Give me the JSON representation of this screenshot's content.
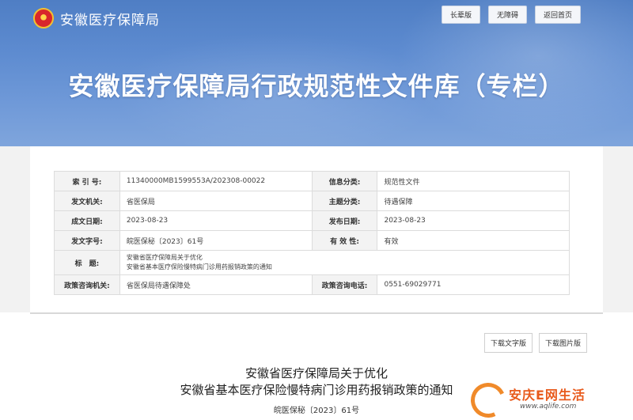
{
  "header": {
    "brand_name": "安徽医疗保障局",
    "top_buttons": [
      "长辈版",
      "无障碍",
      "返回首页"
    ],
    "banner_title": "安徽医疗保障局行政规范性文件库（专栏）"
  },
  "info": {
    "index_label": "索 引 号:",
    "index_value": "11340000MB1599553A/202308-00022",
    "category_label": "信息分类:",
    "category_value": "规范性文件",
    "issuer_label": "发文机关:",
    "issuer_value": "省医保局",
    "topic_label": "主题分类:",
    "topic_value": "待遇保障",
    "created_label": "成文日期:",
    "created_value": "2023-08-23",
    "published_label": "发布日期:",
    "published_value": "2023-08-23",
    "docnum_label": "发文字号:",
    "docnum_value": "皖医保秘〔2023〕61号",
    "validity_label": "有 效 性:",
    "validity_value": "有效",
    "title_label": "标　题:",
    "title_line1": "安徽省医疗保障局关于优化",
    "title_line2": "安徽省基本医疗保险慢特病门诊用药报销政策的通知",
    "consult_org_label": "政策咨询机关:",
    "consult_org_value": "省医保局待遇保障处",
    "consult_tel_label": "政策咨询电话:",
    "consult_tel_value": "0551-69029771"
  },
  "downloads": {
    "text_version": "下载文字版",
    "image_version": "下载图片版"
  },
  "document": {
    "title_line1": "安徽省医疗保障局关于优化",
    "title_line2": "安徽省基本医疗保险慢特病门诊用药报销政策的通知",
    "doc_number": "皖医保秘〔2023〕61号"
  },
  "watermark": {
    "text": "安庆E网生活",
    "url": "www.aqlife.com"
  }
}
